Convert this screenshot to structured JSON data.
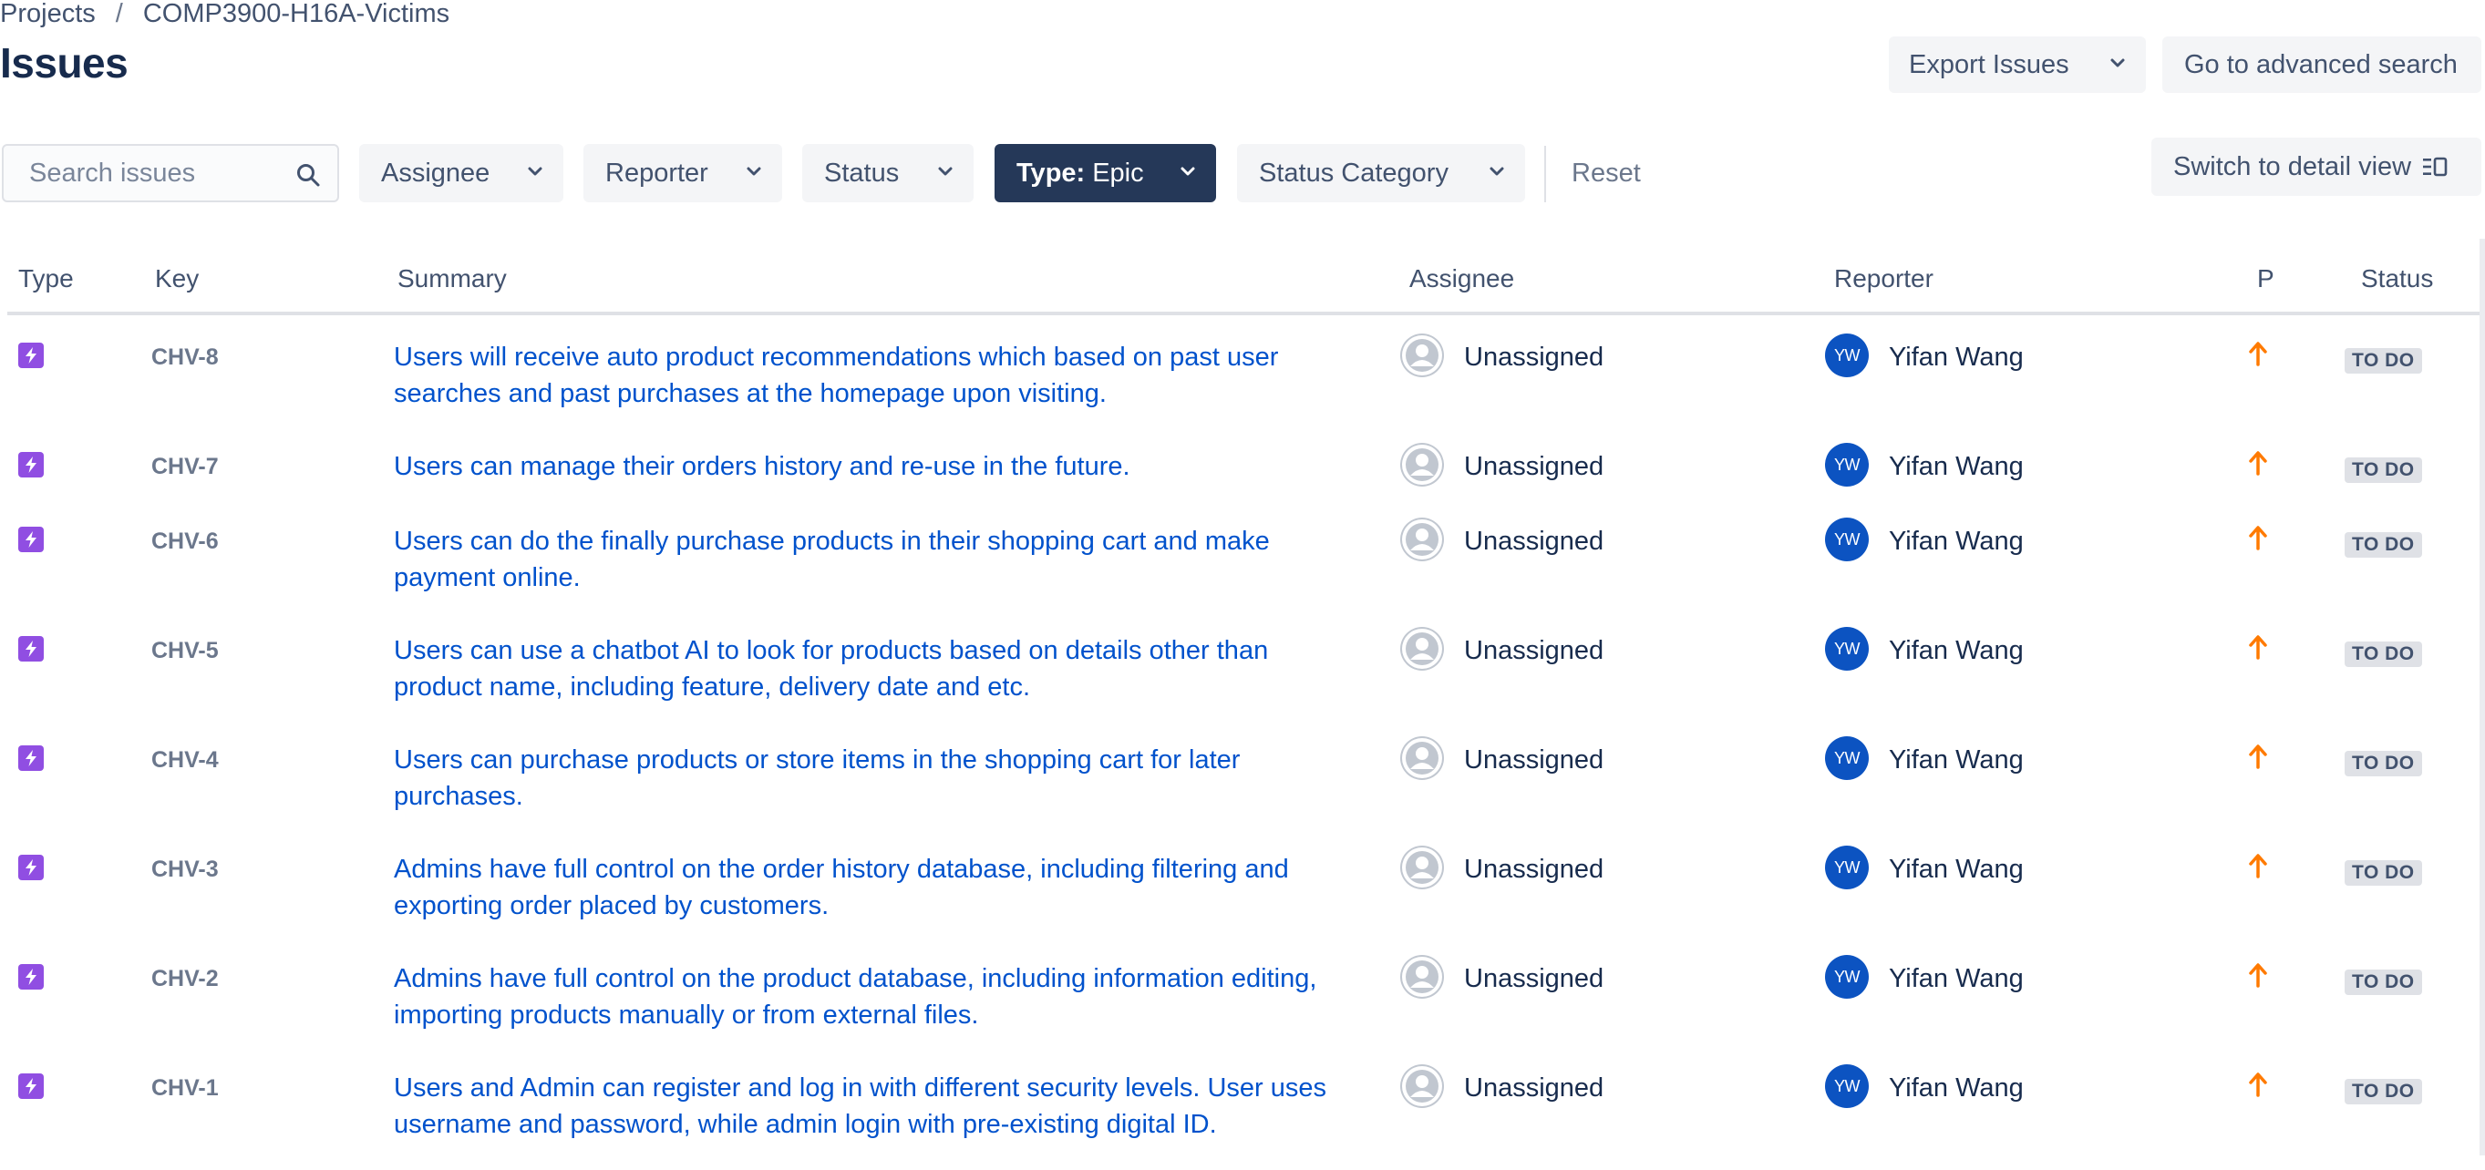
{
  "breadcrumb": {
    "root": "Projects",
    "separator": "/",
    "project": "COMP3900-H16A-Victims"
  },
  "page_title": "Issues",
  "actions": {
    "export_label": "Export Issues",
    "advanced_label": "Go to advanced search",
    "detail_view_label": "Switch to detail view"
  },
  "filters": {
    "search_placeholder": "Search issues",
    "assignee": "Assignee",
    "reporter": "Reporter",
    "status": "Status",
    "type_prefix": "Type:",
    "type_value": "Epic",
    "status_category": "Status Category",
    "reset": "Reset"
  },
  "columns": {
    "type": "Type",
    "key": "Key",
    "summary": "Summary",
    "assignee": "Assignee",
    "reporter": "Reporter",
    "priority": "P",
    "status": "Status"
  },
  "issues": [
    {
      "key": "CHV-8",
      "summary": "Users will receive auto product recommendations which based on past user searches and past purchases at the homepage upon visiting.",
      "assignee": "Unassigned",
      "reporter_initials": "YW",
      "reporter": "Yifan Wang",
      "status": "TO DO"
    },
    {
      "key": "CHV-7",
      "summary": "Users can manage their orders history and re-use in the future.",
      "assignee": "Unassigned",
      "reporter_initials": "YW",
      "reporter": "Yifan Wang",
      "status": "TO DO"
    },
    {
      "key": "CHV-6",
      "summary": "Users can do the finally purchase products in their shopping cart and make payment online.",
      "assignee": "Unassigned",
      "reporter_initials": "YW",
      "reporter": "Yifan Wang",
      "status": "TO DO"
    },
    {
      "key": "CHV-5",
      "summary": "Users can use a chatbot AI to look for products based on details other than product name, including feature, delivery date and etc.",
      "assignee": "Unassigned",
      "reporter_initials": "YW",
      "reporter": "Yifan Wang",
      "status": "TO DO"
    },
    {
      "key": "CHV-4",
      "summary": "Users can purchase products or store items in the shopping cart for later purchases.",
      "assignee": "Unassigned",
      "reporter_initials": "YW",
      "reporter": "Yifan Wang",
      "status": "TO DO"
    },
    {
      "key": "CHV-3",
      "summary": "Admins have full control on the order history database, including filtering and exporting order placed by customers.",
      "assignee": "Unassigned",
      "reporter_initials": "YW",
      "reporter": "Yifan Wang",
      "status": "TO DO"
    },
    {
      "key": "CHV-2",
      "summary": "Admins have full control on the product database, including information editing, importing products manually or from external files.",
      "assignee": "Unassigned",
      "reporter_initials": "YW",
      "reporter": "Yifan Wang",
      "status": "TO DO"
    },
    {
      "key": "CHV-1",
      "summary": "Users and Admin can register and log in with different security levels. User uses username and password, while admin login with pre-existing digital ID.",
      "assignee": "Unassigned",
      "reporter_initials": "YW",
      "reporter": "Yifan Wang",
      "status": "TO DO"
    }
  ],
  "icons": {
    "type": "epic-icon",
    "priority": "priority-high-arrow-icon",
    "assignee": "default-avatar-icon"
  },
  "colors": {
    "link": "#0052cc",
    "epic": "#904ee2",
    "priority": "#ff7a00",
    "active_filter": "#253858",
    "avatar": "#0c53c1"
  }
}
